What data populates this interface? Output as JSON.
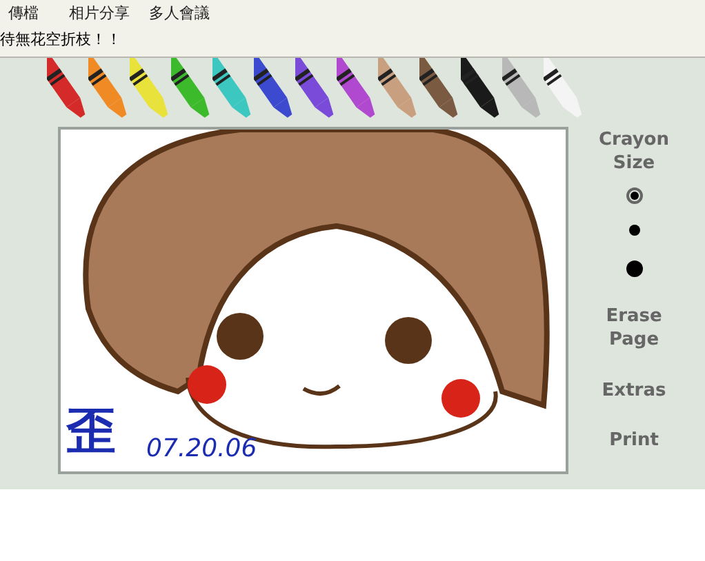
{
  "menu": [
    {
      "label": "傳檔"
    },
    {
      "label": "相片分享"
    },
    {
      "label": "多人會議"
    }
  ],
  "caption": "待無花空折枝！！",
  "crayons": [
    {
      "color": "#d42a2a"
    },
    {
      "color": "#f08a24"
    },
    {
      "color": "#e8e23a"
    },
    {
      "color": "#3cba2c"
    },
    {
      "color": "#3cc8c0"
    },
    {
      "color": "#3c4ad0"
    },
    {
      "color": "#7a4ad8"
    },
    {
      "color": "#b048d0"
    },
    {
      "color": "#c8a080"
    },
    {
      "color": "#7a5a40"
    },
    {
      "color": "#1a1a1a"
    },
    {
      "color": "#b8b8b8"
    },
    {
      "color": "#f4f4f4"
    }
  ],
  "canvas": {
    "signature": "歪",
    "date": "07.20.06"
  },
  "sidebar": {
    "size_label": "Crayon Size",
    "sizes": [
      {
        "kind": "small",
        "selected": true
      },
      {
        "kind": "medium",
        "selected": false
      },
      {
        "kind": "large",
        "selected": false
      }
    ],
    "buttons": [
      {
        "label": "Erase Page"
      },
      {
        "label": "Extras"
      },
      {
        "label": "Print"
      }
    ]
  }
}
